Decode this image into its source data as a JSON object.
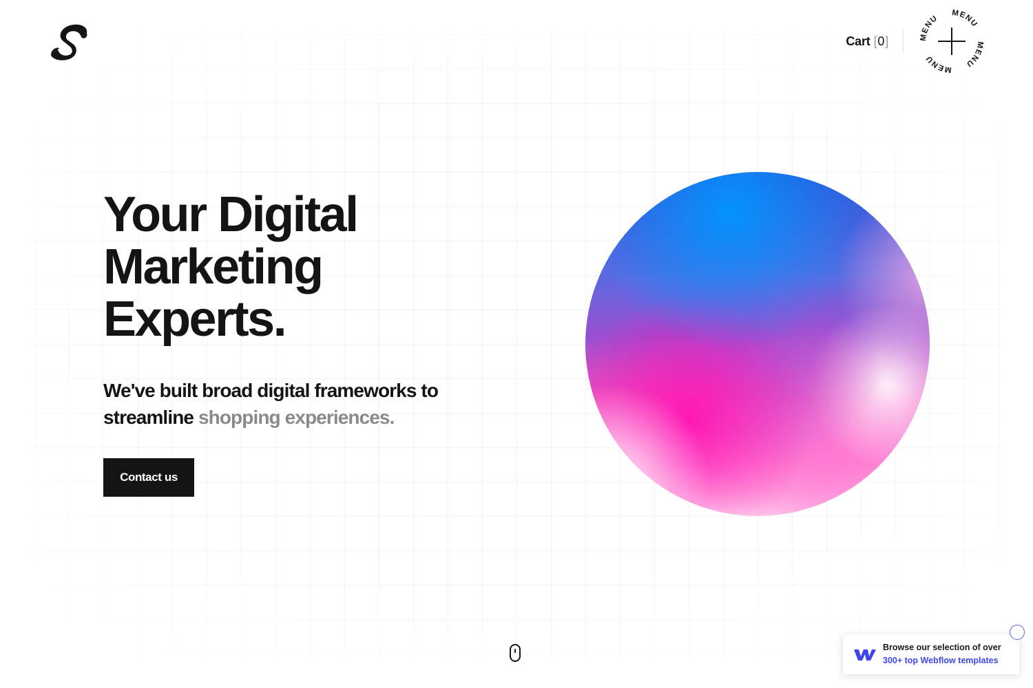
{
  "header": {
    "cart_label": "Cart",
    "cart_bracket_open": "[",
    "cart_count": "0",
    "cart_bracket_close": "]",
    "menu_label": "MENU"
  },
  "hero": {
    "title_lines": [
      "Your Digital",
      "Marketing",
      "Experts."
    ],
    "subtitle_dark": "We've built broad digital frameworks to streamline",
    "subtitle_muted": "shopping experiences.",
    "cta_label": "Contact us"
  },
  "badge": {
    "line1": "Browse our selection of over",
    "line2": "300+ top Webflow templates"
  },
  "icons": {
    "logo": "brand-s-logo-icon",
    "menu": "plus-menu-icon",
    "scroll": "mouse-scroll-icon",
    "webflow": "webflow-logo-icon"
  },
  "colors": {
    "text": "#141414",
    "muted": "#8a8a8a",
    "button_bg": "#141414",
    "webflow_blue": "#3f46e8",
    "orb_blue": "#0096ff",
    "orb_pink": "#ff14b4"
  }
}
